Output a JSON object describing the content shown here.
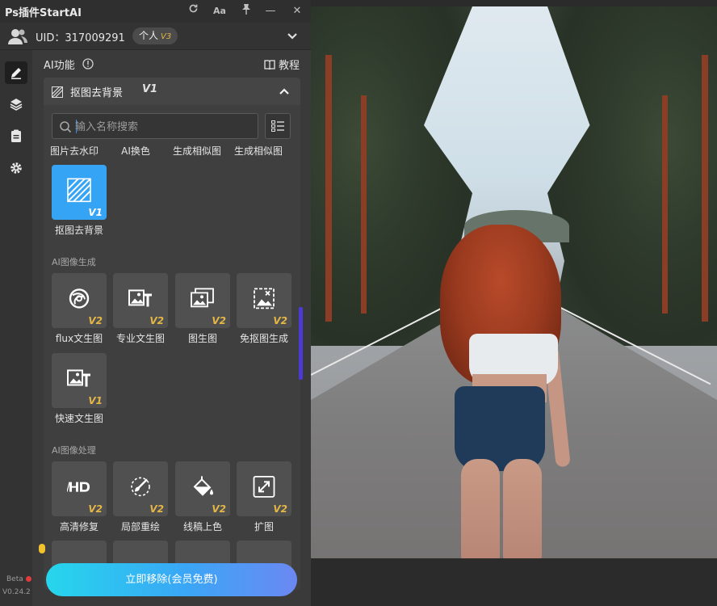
{
  "window": {
    "title": "Ps插件StartAI"
  },
  "titlebar": {
    "refresh_icon": "refresh-icon",
    "font_label": "Aa",
    "pin_icon": "pin-icon",
    "minimize_label": "—",
    "close_label": "✕"
  },
  "user": {
    "uid_label": "UID：317009291",
    "plan": "个人",
    "plan_version": "V3"
  },
  "rail": {
    "icons": [
      "edit-icon",
      "layers-icon",
      "clipboard-icon",
      "gear-icon"
    ],
    "beta": "Beta",
    "version": "V0.24.2"
  },
  "ai": {
    "heading": "AI功能",
    "tutorial": "教程"
  },
  "feature": {
    "name": "抠图去背景",
    "version": "V1"
  },
  "search": {
    "placeholder": "输入名称搜索"
  },
  "top_row_labels": [
    "图片去水印",
    "AI换色",
    "生成相似图",
    "生成相似图"
  ],
  "selected_tile": {
    "label": "抠图去背景",
    "version": "V1"
  },
  "sections": [
    {
      "title": "AI图像生成",
      "tiles": [
        {
          "label": "flux文生图",
          "version": "V2",
          "icon": "flux-icon"
        },
        {
          "label": "专业文生图",
          "version": "V2",
          "icon": "image-text-icon"
        },
        {
          "label": "图生图",
          "version": "V2",
          "icon": "image-to-image-icon"
        },
        {
          "label": "免抠图生成",
          "version": "V2",
          "icon": "cutout-free-icon"
        },
        {
          "label": "快速文生图",
          "version": "V1",
          "icon": "image-text-icon"
        }
      ]
    },
    {
      "title": "AI图像处理",
      "tiles": [
        {
          "label": "高清修复",
          "version": "V2",
          "icon": "hd-icon"
        },
        {
          "label": "局部重绘",
          "version": "V2",
          "icon": "brush-icon"
        },
        {
          "label": "线稿上色",
          "version": "V2",
          "icon": "paint-bucket-icon"
        },
        {
          "label": "扩图",
          "version": "V2",
          "icon": "expand-icon"
        }
      ]
    }
  ],
  "cta": {
    "label": "立即移除(会员免费)"
  },
  "colors": {
    "accent": "#36a4f4",
    "version_tag": "#e4b646",
    "panel_bg": "#3a3a3a"
  }
}
